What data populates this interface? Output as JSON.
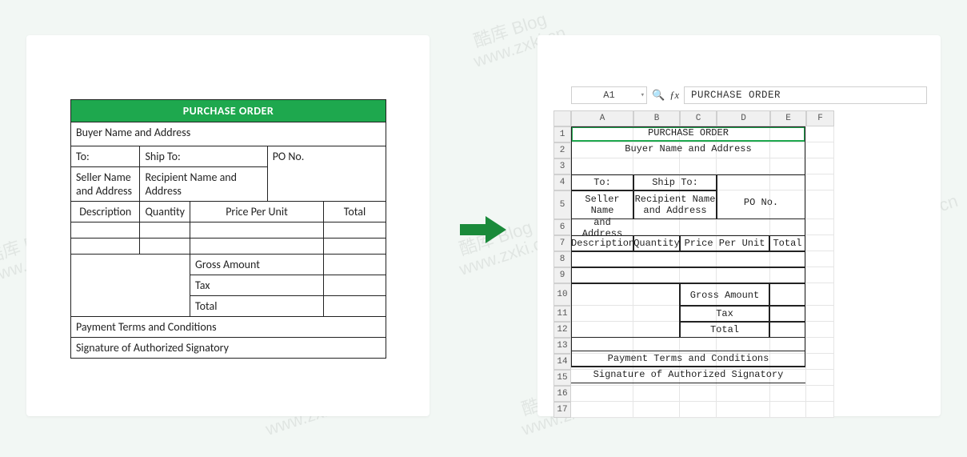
{
  "watermarks": [
    "酷库 Blog",
    "www.zxki.cn"
  ],
  "word_table": {
    "header": "PURCHASE ORDER",
    "buyer": "Buyer Name and Address",
    "to": "To:",
    "ship_to": "Ship To:",
    "seller": "Seller Name and Address",
    "recipient": "Recipient Name and Address",
    "po_no": "PO No.",
    "cols": {
      "desc": "Description",
      "qty": "Quantity",
      "ppu": "Price Per Unit",
      "total": "Total"
    },
    "summary": {
      "gross": "Gross Amount",
      "tax": "Tax",
      "total": "Total"
    },
    "terms": "Payment Terms and Conditions",
    "signature": "Signature of Authorized Signatory"
  },
  "excel": {
    "name_box": "A1",
    "formula_bar": "PURCHASE ORDER",
    "columns": [
      "A",
      "B",
      "C",
      "D",
      "E",
      "F"
    ],
    "rows": [
      "1",
      "2",
      "3",
      "4",
      "5",
      "6",
      "7",
      "8",
      "9",
      "10",
      "11",
      "12",
      "13",
      "14",
      "15",
      "16",
      "17"
    ],
    "cells": {
      "r1_title": "PURCHASE ORDER",
      "r2_buyer": "Buyer Name and Address",
      "r4_to": "To:",
      "r4_ship_to": "Ship To:",
      "r5_seller": "Seller Name\nand Address",
      "r5_recipient": "Recipient Name\nand Address",
      "r5_po": "PO No.",
      "r7_desc": "Description",
      "r7_qty": "Quantity",
      "r7_ppu": "Price Per Unit",
      "r7_total": "Total",
      "r10_gross": "Gross Amount",
      "r11_tax": "Tax",
      "r12_total": "Total",
      "r14_terms": "Payment Terms and Conditions",
      "r15_sign": "Signature of Authorized Signatory"
    }
  }
}
